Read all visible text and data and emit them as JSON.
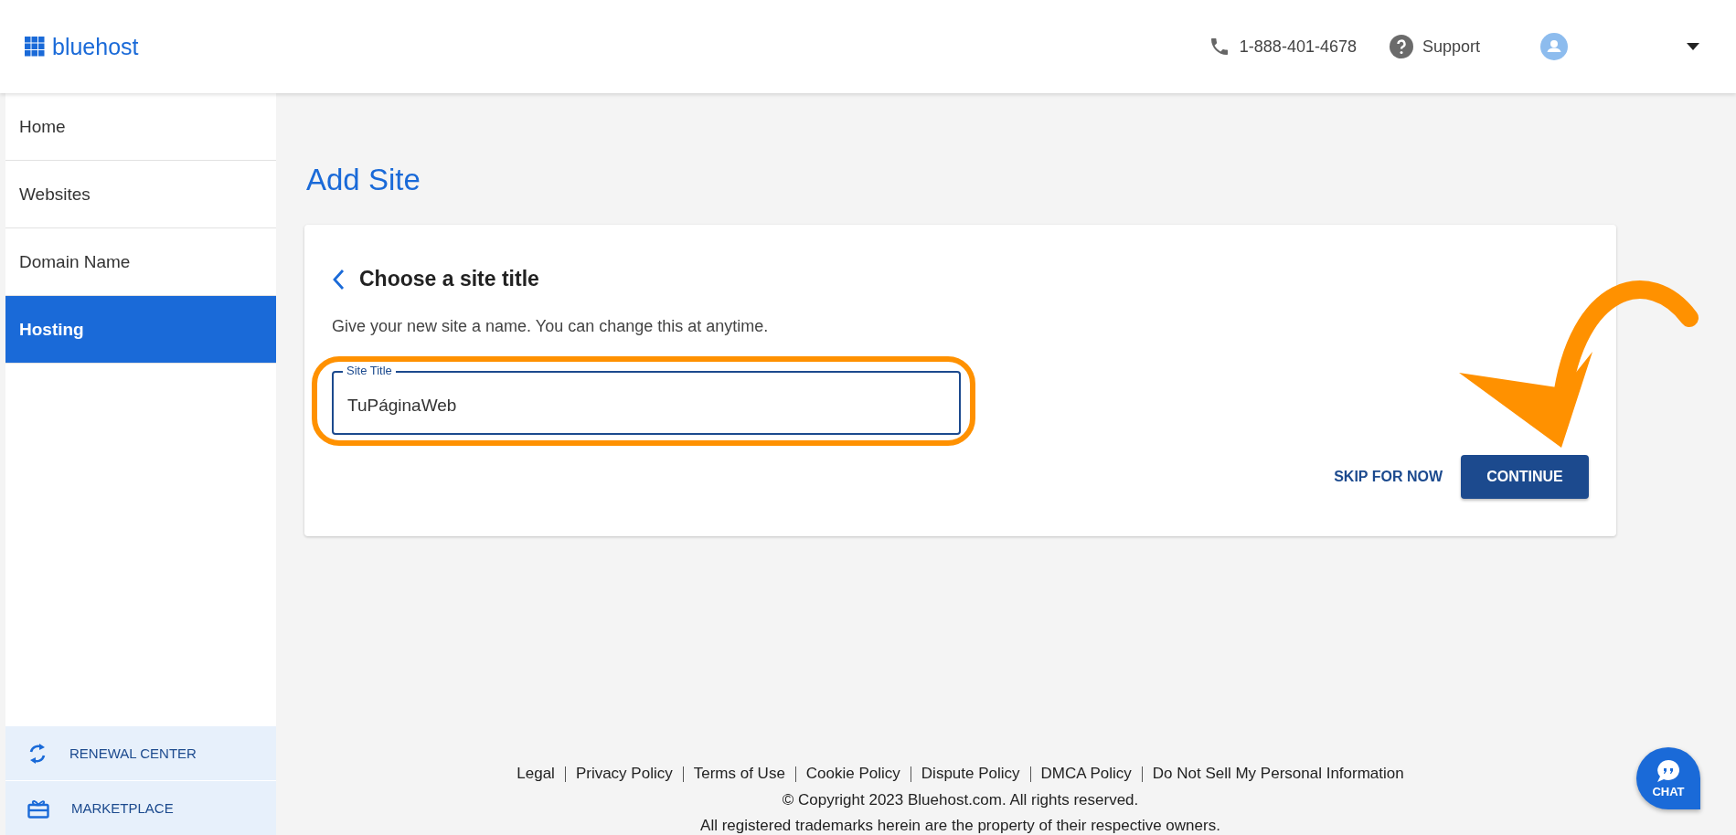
{
  "header": {
    "logo": "bluehost",
    "phone": "1-888-401-4678",
    "support": "Support"
  },
  "sidebar": {
    "items": [
      {
        "label": "Home",
        "selected": false
      },
      {
        "label": "Websites",
        "selected": false
      },
      {
        "label": "Domain Name",
        "selected": false
      },
      {
        "label": "Hosting",
        "selected": true
      }
    ],
    "bottom_items": [
      {
        "label": "RENEWAL CENTER",
        "kind": "renewal"
      },
      {
        "label": "MARKETPLACE",
        "kind": "marketplace"
      }
    ]
  },
  "page_title": "Add Site",
  "card": {
    "title": "Choose a site title",
    "description": "Give your new site a name. You can change this at anytime.",
    "field": {
      "label": "Site Title",
      "value": "TuPáginaWeb"
    },
    "buttons": [
      {
        "label": "SKIP FOR NOW",
        "kind": "text"
      },
      {
        "label": "CONTINUE",
        "kind": "primary"
      }
    ]
  },
  "footer": {
    "links": [
      "Legal",
      "Privacy Policy",
      "Terms of Use",
      "Cookie Policy",
      "Dispute Policy",
      "DMCA Policy",
      "Do Not Sell My Personal Information"
    ],
    "copyright": "© Copyright 2023 Bluehost.com. All rights reserved.",
    "trademark": "All registered trademarks herein are the property of their respective owners."
  },
  "chat": {
    "label": "CHAT"
  }
}
